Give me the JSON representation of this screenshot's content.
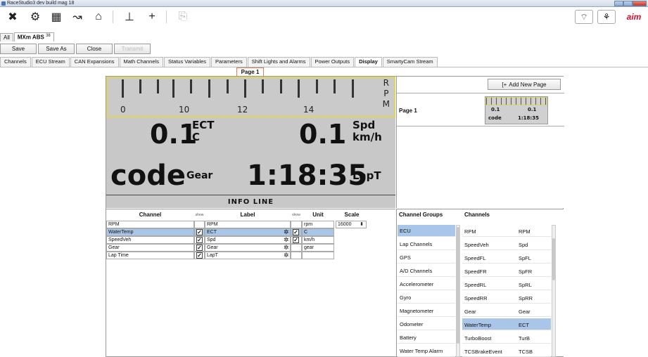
{
  "window": {
    "title": "RaceStudio3 dev build mag 18"
  },
  "toolbar": {
    "buttons": [
      "tools-icon",
      "settings-icon",
      "dashboard-icon",
      "track-icon",
      "device-icon",
      "logger-icon",
      "add-icon",
      "link-icon"
    ],
    "right": [
      "wifi-icon",
      "network-icon",
      "aim-logo"
    ]
  },
  "device_tabs": [
    {
      "label": "All"
    },
    {
      "label": "MXm ABS",
      "sup": "38"
    }
  ],
  "actions": {
    "save": "Save",
    "save_as": "Save As",
    "close": "Close",
    "transmit": "Transmit"
  },
  "config_tabs": [
    "Channels",
    "ECU Stream",
    "CAN Expansions",
    "Math Channels",
    "Status Variables",
    "Parameters",
    "Shift Lights and Alarms",
    "Power Outputs",
    "Display",
    "SmartyCam Stream"
  ],
  "active_config_tab": "Display",
  "page_label": "Page 1",
  "display": {
    "rpm_ticks": [
      "0",
      "10",
      "12",
      "14"
    ],
    "rpm_tag": "RPM",
    "field1_value": "0.1",
    "field1_label": "ECT",
    "field1_unit": "C",
    "field2_value": "0.1",
    "field2_label": "Spd",
    "field2_unit": "km/h",
    "field3_value": "code",
    "field3_label": "Gear",
    "field4_value": "1:18:35",
    "field4_label": "LapT",
    "info_line": "INFO LINE"
  },
  "pages": {
    "add_button": "Add New Page",
    "items": [
      {
        "label": "Page 1"
      }
    ]
  },
  "grid": {
    "headers": {
      "channel": "Channel",
      "show1": "show",
      "label": "Label",
      "show2": "show",
      "unit": "Unit",
      "scale": "Scale"
    },
    "rows": [
      {
        "channel": "RPM",
        "show1": false,
        "label": "RPM",
        "show2": false,
        "unit": "rpm",
        "scale": "16000",
        "selected": false
      },
      {
        "channel": "WaterTemp",
        "show1": true,
        "label": "ECT",
        "show2": true,
        "unit": "C",
        "scale": "",
        "selected": true
      },
      {
        "channel": "SpeedVeh",
        "show1": true,
        "label": "Spd",
        "show2": true,
        "unit": "km/h",
        "scale": "",
        "selected": false
      },
      {
        "channel": "Gear",
        "show1": true,
        "label": "Gear",
        "show2": false,
        "unit": "gear",
        "scale": "",
        "selected": false
      },
      {
        "channel": "Lap Time",
        "show1": true,
        "label": "LapT",
        "show2": false,
        "unit": "",
        "scale": "",
        "selected": false
      }
    ]
  },
  "channel_groups": {
    "header": "Channel Groups",
    "items": [
      "ECU",
      "Lap Channels",
      "GPS",
      "A/D Channels",
      "Accelerometer",
      "Gyro",
      "Magnetometer",
      "Odometer",
      "Battery",
      "Water Temp Alarm"
    ],
    "selected": "ECU"
  },
  "channels": {
    "header": "Channels",
    "items": [
      {
        "name": "RPM",
        "abbr": "RPM"
      },
      {
        "name": "SpeedVeh",
        "abbr": "Spd"
      },
      {
        "name": "SpeedFL",
        "abbr": "SpFL"
      },
      {
        "name": "SpeedFR",
        "abbr": "SpFR"
      },
      {
        "name": "SpeedRL",
        "abbr": "SpRL"
      },
      {
        "name": "SpeedRR",
        "abbr": "SpRR"
      },
      {
        "name": "Gear",
        "abbr": "Gear"
      },
      {
        "name": "WaterTemp",
        "abbr": "ECT"
      },
      {
        "name": "TurboBoost",
        "abbr": "TurB"
      },
      {
        "name": "TCSBrakeEvent",
        "abbr": "TCSB"
      }
    ],
    "selected": "WaterTemp"
  },
  "colors": {
    "selection": "#a9c5e8",
    "display_bg": "#c8c8c8",
    "rpm_border": "#e0d35f",
    "page_highlight": "#e07d5b",
    "brand": "#d0112b"
  }
}
